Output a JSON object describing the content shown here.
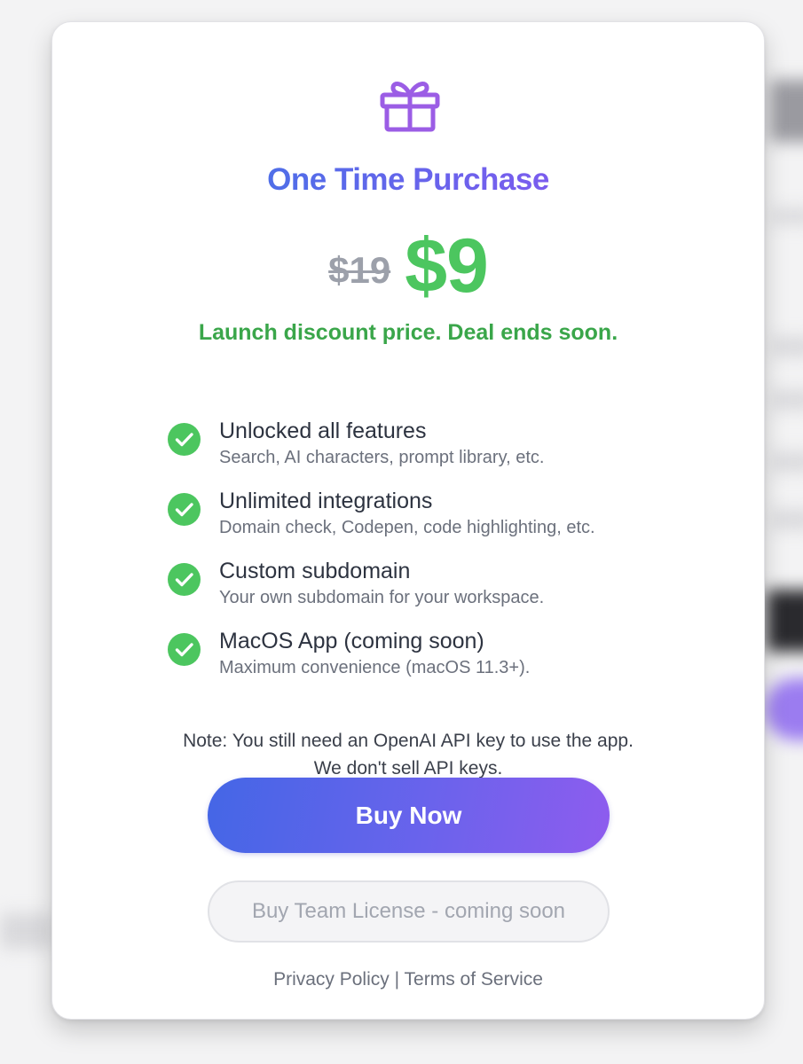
{
  "card": {
    "icon": "gift-icon",
    "title": "One Time Purchase",
    "old_price": "$19",
    "new_price": "$9",
    "discount_text": "Launch discount price. Deal ends soon.",
    "features": [
      {
        "icon": "check-circle-icon",
        "title": "Unlocked all features",
        "description": "Search, AI characters, prompt library, etc."
      },
      {
        "icon": "check-circle-icon",
        "title": "Unlimited integrations",
        "description": "Domain check, Codepen, code highlighting, etc."
      },
      {
        "icon": "check-circle-icon",
        "title": "Custom subdomain",
        "description": "Your own subdomain for your workspace."
      },
      {
        "icon": "check-circle-icon",
        "title": "MacOS App (coming soon)",
        "description": "Maximum convenience (macOS 11.3+)."
      }
    ],
    "note_line1": "Note: You still need an OpenAI API key to use the app.",
    "note_line2": "We don't sell API keys.",
    "buy_button_label": "Buy Now",
    "team_button_label": "Buy Team License - coming soon",
    "footer": {
      "privacy_label": "Privacy Policy",
      "separator": "|",
      "terms_label": "Terms of Service"
    }
  },
  "colors": {
    "title_gradient_start": "#4f6ee8",
    "title_gradient_end": "#7a5cee",
    "price_green": "#4cc65f",
    "discount_green": "#3aa64a",
    "old_price_gray": "#9ca0aa",
    "gift_purple": "#9b5de5",
    "button_gradient_start": "#4466e6",
    "button_gradient_end": "#8e5cee"
  }
}
